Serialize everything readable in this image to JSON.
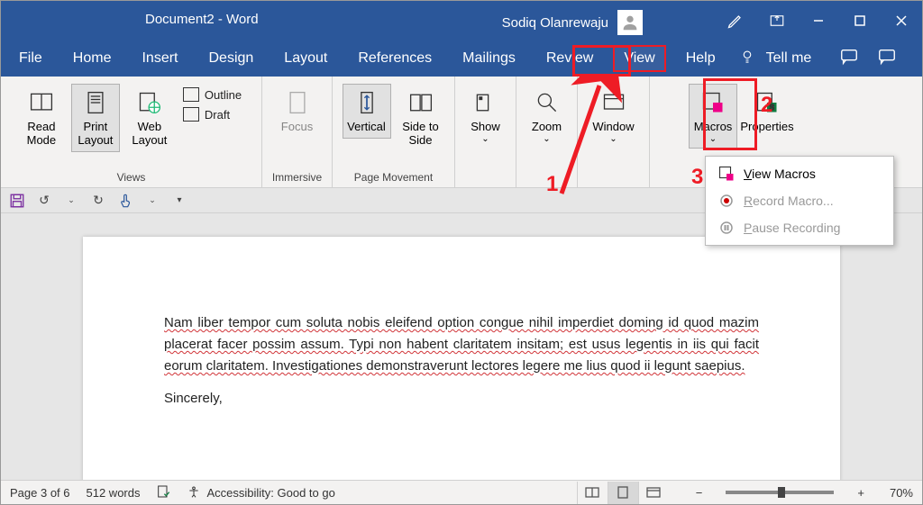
{
  "titlebar": {
    "title": "Document2  -  Word",
    "username": "Sodiq Olanrewaju"
  },
  "menubar": {
    "items": [
      "File",
      "Home",
      "Insert",
      "Design",
      "Layout",
      "References",
      "Mailings",
      "Review",
      "View",
      "Help"
    ],
    "tellme": "Tell me"
  },
  "ribbon": {
    "views_group_label": "Views",
    "read_mode": "Read Mode",
    "print_layout": "Print Layout",
    "web_layout": "Web Layout",
    "outline": "Outline",
    "draft": "Draft",
    "immersive_label": "Immersive",
    "focus": "Focus",
    "page_movement_label": "Page Movement",
    "vertical": "Vertical",
    "side_to_side": "Side to Side",
    "show": "Show",
    "zoom": "Zoom",
    "window": "Window",
    "macros": "Macros",
    "properties": "Properties"
  },
  "dropdown": {
    "view_macros": "View Macros",
    "record_macro": "Record Macro...",
    "pause_recording": "Pause Recording"
  },
  "document": {
    "para1": "Nam liber tempor cum soluta nobis eleifend option congue nihil imperdiet doming id quod mazim placerat facer possim assum. Typi non habent claritatem insitam; est usus legentis in iis qui facit eorum claritatem. Investigationes demonstraverunt lectores legere me lius quod ii legunt saepius.",
    "signoff": "Sincerely,"
  },
  "statusbar": {
    "page": "Page 3 of 6",
    "words": "512 words",
    "accessibility": "Accessibility: Good to go",
    "zoom_pct": "70%"
  },
  "annotations": {
    "num1": "1",
    "num2": "2",
    "num3": "3"
  }
}
